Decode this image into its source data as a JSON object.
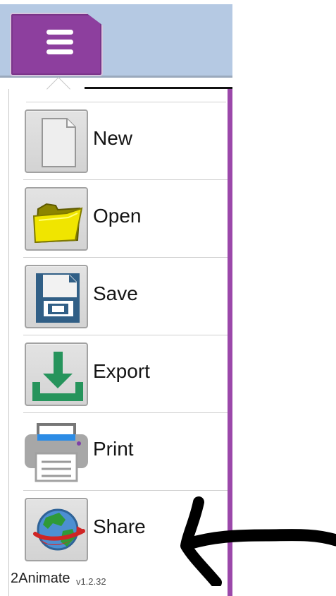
{
  "toolbar": {
    "menu_icon": "hamburger-icon",
    "accent_color": "#8d3f9e",
    "bar_color": "#b5c9e3"
  },
  "menu": {
    "items": [
      {
        "label": "New",
        "icon": "new-document-icon"
      },
      {
        "label": "Open",
        "icon": "folder-icon"
      },
      {
        "label": "Save",
        "icon": "floppy-disk-icon"
      },
      {
        "label": "Export",
        "icon": "download-icon"
      },
      {
        "label": "Print",
        "icon": "printer-icon"
      },
      {
        "label": "Share",
        "icon": "globe-share-icon"
      }
    ]
  },
  "brand": {
    "name": "2Animate",
    "version": "v1.2.32"
  }
}
